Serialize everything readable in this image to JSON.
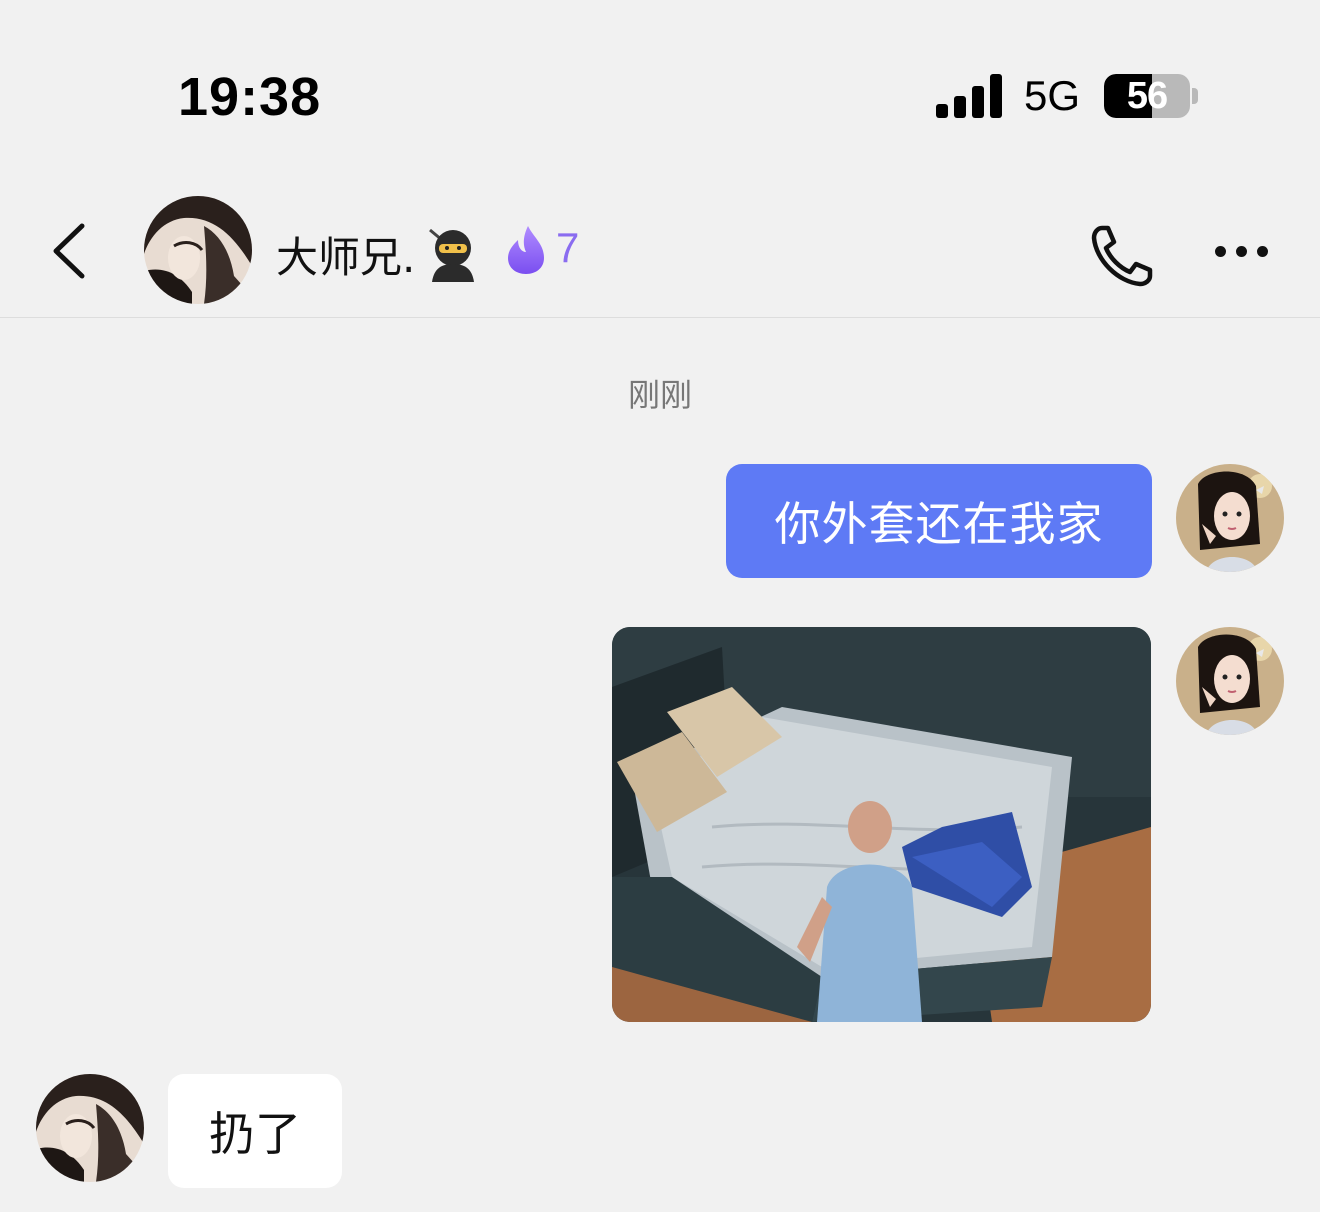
{
  "status_bar": {
    "time": "19:38",
    "network": "5G",
    "battery_percent": 56,
    "battery_label": "56",
    "signal_bars": 4
  },
  "header": {
    "contact_name": "大师兄.",
    "name_emoji_icon": "ninja-emoji-icon",
    "streak_icon": "purple-flame-icon",
    "streak_count": "7",
    "streak_color": "#8a6cf0"
  },
  "chat": {
    "timestamp": "刚刚",
    "messages": [
      {
        "from": "me",
        "type": "text",
        "text": "你外套还在我家"
      },
      {
        "from": "me",
        "type": "image",
        "image_desc": "bed-scene-image"
      },
      {
        "from": "them",
        "type": "text",
        "text": "扔了"
      }
    ]
  },
  "colors": {
    "background": "#f1f1f1",
    "outgoing_bubble": "#5e7af5",
    "incoming_bubble": "#ffffff"
  }
}
